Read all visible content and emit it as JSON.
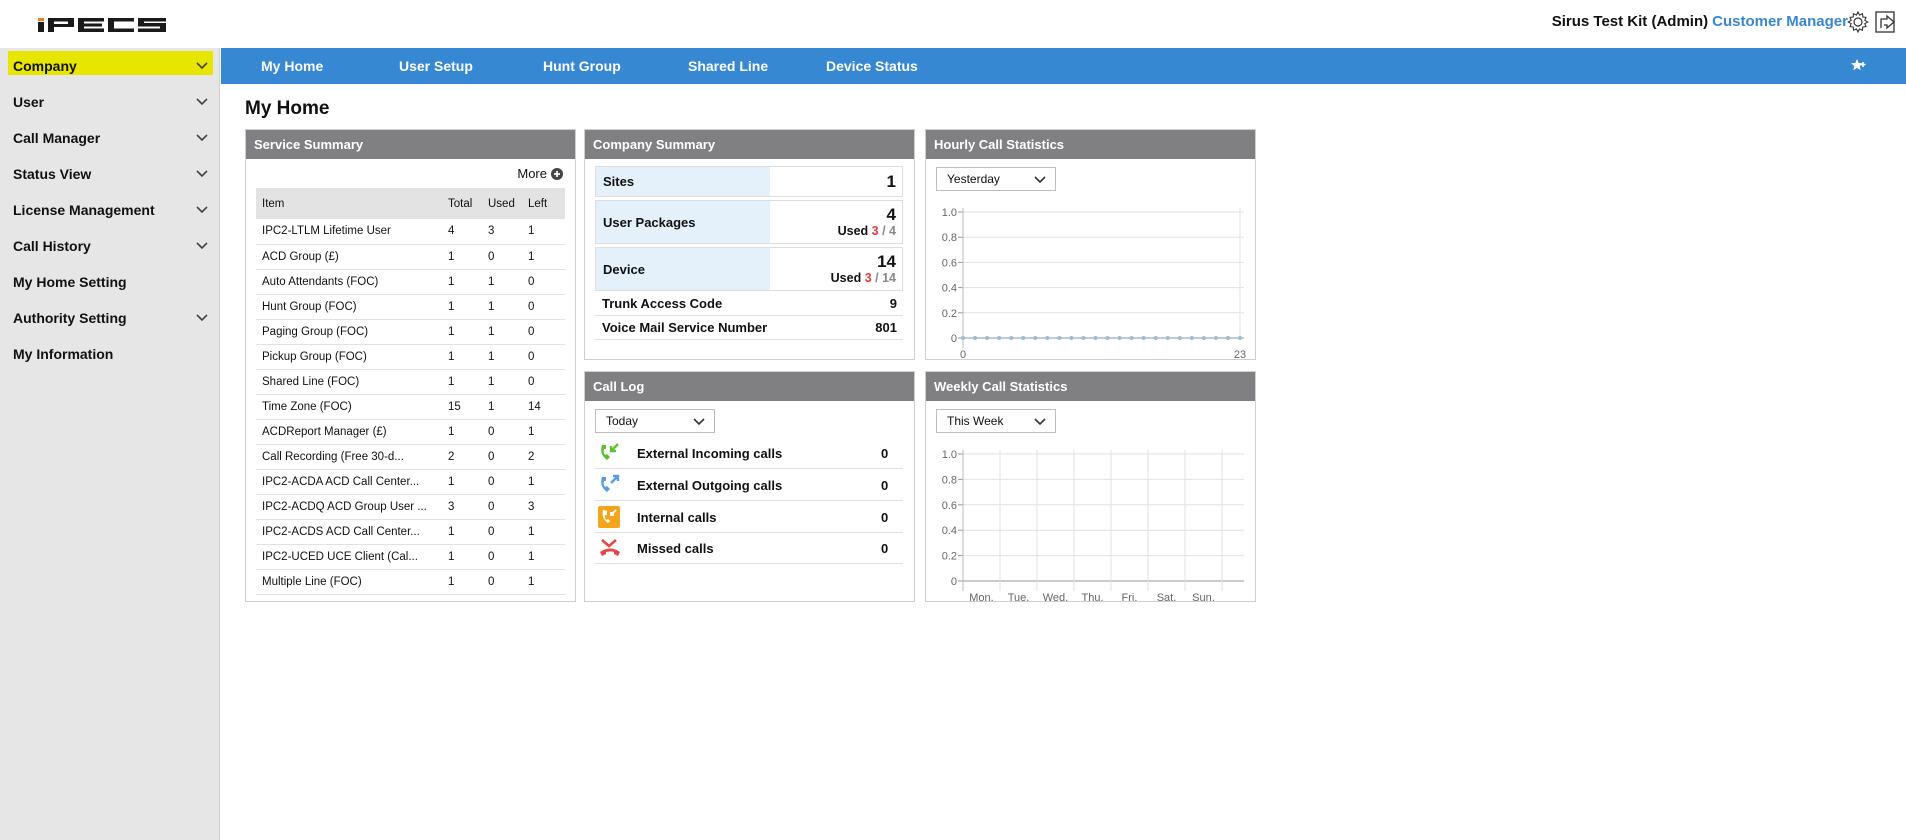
{
  "header": {
    "logo_text": "iPECS",
    "user_name": "Sirus Test Kit (Admin)",
    "user_role": "Customer Manager",
    "icons": [
      "gear-icon",
      "logout-icon"
    ]
  },
  "sidebar": {
    "items": [
      {
        "label": "Company",
        "expandable": true,
        "highlighted": true
      },
      {
        "label": "User",
        "expandable": true
      },
      {
        "label": "Call Manager",
        "expandable": true
      },
      {
        "label": "Status View",
        "expandable": true
      },
      {
        "label": "License Management",
        "expandable": true
      },
      {
        "label": "Call History",
        "expandable": true
      },
      {
        "label": "My Home Setting",
        "expandable": false
      },
      {
        "label": "Authority Setting",
        "expandable": true
      },
      {
        "label": "My Information",
        "expandable": false
      }
    ]
  },
  "navbar": {
    "tabs": [
      {
        "label": "My Home"
      },
      {
        "label": "User Setup"
      },
      {
        "label": "Hunt Group"
      },
      {
        "label": "Shared Line"
      },
      {
        "label": "Device Status"
      }
    ],
    "favorite_icon": "star-plus-icon"
  },
  "page": {
    "title": "My Home"
  },
  "service_summary": {
    "title": "Service Summary",
    "more_label": "More",
    "columns": [
      "Item",
      "Total",
      "Used",
      "Left"
    ],
    "rows": [
      [
        "IPC2-LTLM Lifetime User",
        "4",
        "3",
        "1"
      ],
      [
        "ACD Group (£)",
        "1",
        "0",
        "1"
      ],
      [
        "Auto Attendants (FOC)",
        "1",
        "1",
        "0"
      ],
      [
        "Hunt Group (FOC)",
        "1",
        "1",
        "0"
      ],
      [
        "Paging Group (FOC)",
        "1",
        "1",
        "0"
      ],
      [
        "Pickup Group (FOC)",
        "1",
        "1",
        "0"
      ],
      [
        "Shared Line (FOC)",
        "1",
        "1",
        "0"
      ],
      [
        "Time Zone (FOC)",
        "15",
        "1",
        "14"
      ],
      [
        "ACDReport Manager (£)",
        "1",
        "0",
        "1"
      ],
      [
        "Call Recording (Free 30-d...",
        "2",
        "0",
        "2"
      ],
      [
        "IPC2-ACDA ACD Call Center...",
        "1",
        "0",
        "1"
      ],
      [
        "IPC2-ACDQ ACD Group User ...",
        "3",
        "0",
        "3"
      ],
      [
        "IPC2-ACDS ACD Call Center...",
        "1",
        "0",
        "1"
      ],
      [
        "IPC2-UCED UCE Client (Cal...",
        "1",
        "0",
        "1"
      ],
      [
        "Multiple Line (FOC)",
        "1",
        "0",
        "1"
      ]
    ]
  },
  "company_summary": {
    "title": "Company Summary",
    "sites": {
      "label": "Sites",
      "value": "1"
    },
    "user_packages": {
      "label": "User Packages",
      "value": "4",
      "used_label": "Used",
      "used": "3",
      "total": "4"
    },
    "device": {
      "label": "Device",
      "value": "14",
      "used_label": "Used",
      "used": "3",
      "total": "14"
    },
    "trunk_access_code": {
      "label": "Trunk Access Code",
      "value": "9"
    },
    "voice_mail": {
      "label": "Voice Mail Service Number",
      "value": "801"
    }
  },
  "call_log": {
    "title": "Call Log",
    "period": "Today",
    "rows": [
      {
        "label": "External Incoming calls",
        "value": "0",
        "icon": "incoming-call-icon",
        "color": "#5cc22b"
      },
      {
        "label": "External Outgoing calls",
        "value": "0",
        "icon": "outgoing-call-icon",
        "color": "#5b9be6"
      },
      {
        "label": "Internal calls",
        "value": "0",
        "icon": "internal-call-icon",
        "color": "#f3a61c"
      },
      {
        "label": "Missed calls",
        "value": "0",
        "icon": "missed-call-icon",
        "color": "#e94545"
      }
    ]
  },
  "hourly_stats": {
    "title": "Hourly Call Statistics",
    "period": "Yesterday"
  },
  "weekly_stats": {
    "title": "Weekly Call Statistics",
    "period": "This Week"
  },
  "colors": {
    "nav_blue": "#3588d1",
    "panel_header": "#808083",
    "highlight_yellow": "#e6e600",
    "used_red": "#e23a3a"
  },
  "chart_data": [
    {
      "type": "line",
      "title": "Hourly Call Statistics",
      "x": [
        0,
        1,
        2,
        3,
        4,
        5,
        6,
        7,
        8,
        9,
        10,
        11,
        12,
        13,
        14,
        15,
        16,
        17,
        18,
        19,
        20,
        21,
        22,
        23
      ],
      "values": [
        0,
        0,
        0,
        0,
        0,
        0,
        0,
        0,
        0,
        0,
        0,
        0,
        0,
        0,
        0,
        0,
        0,
        0,
        0,
        0,
        0,
        0,
        0,
        0
      ],
      "x_tick_labels": [
        "0",
        "23"
      ],
      "y_tick_labels": [
        "0",
        "0.2",
        "0.4",
        "0.6",
        "0.8",
        "1.0"
      ],
      "xlim": [
        0,
        23
      ],
      "ylim": [
        0,
        1.0
      ],
      "grid": true,
      "series_color": "#9bbdd0"
    },
    {
      "type": "bar",
      "title": "Weekly Call Statistics",
      "categories": [
        "Mon.",
        "Tue.",
        "Wed.",
        "Thu.",
        "Fri.",
        "Sat.",
        "Sun."
      ],
      "values": [
        0,
        0,
        0,
        0,
        0,
        0,
        0
      ],
      "y_tick_labels": [
        "0",
        "0.2",
        "0.4",
        "0.6",
        "0.8",
        "1.0"
      ],
      "ylim": [
        0,
        1.0
      ],
      "grid": true
    }
  ]
}
